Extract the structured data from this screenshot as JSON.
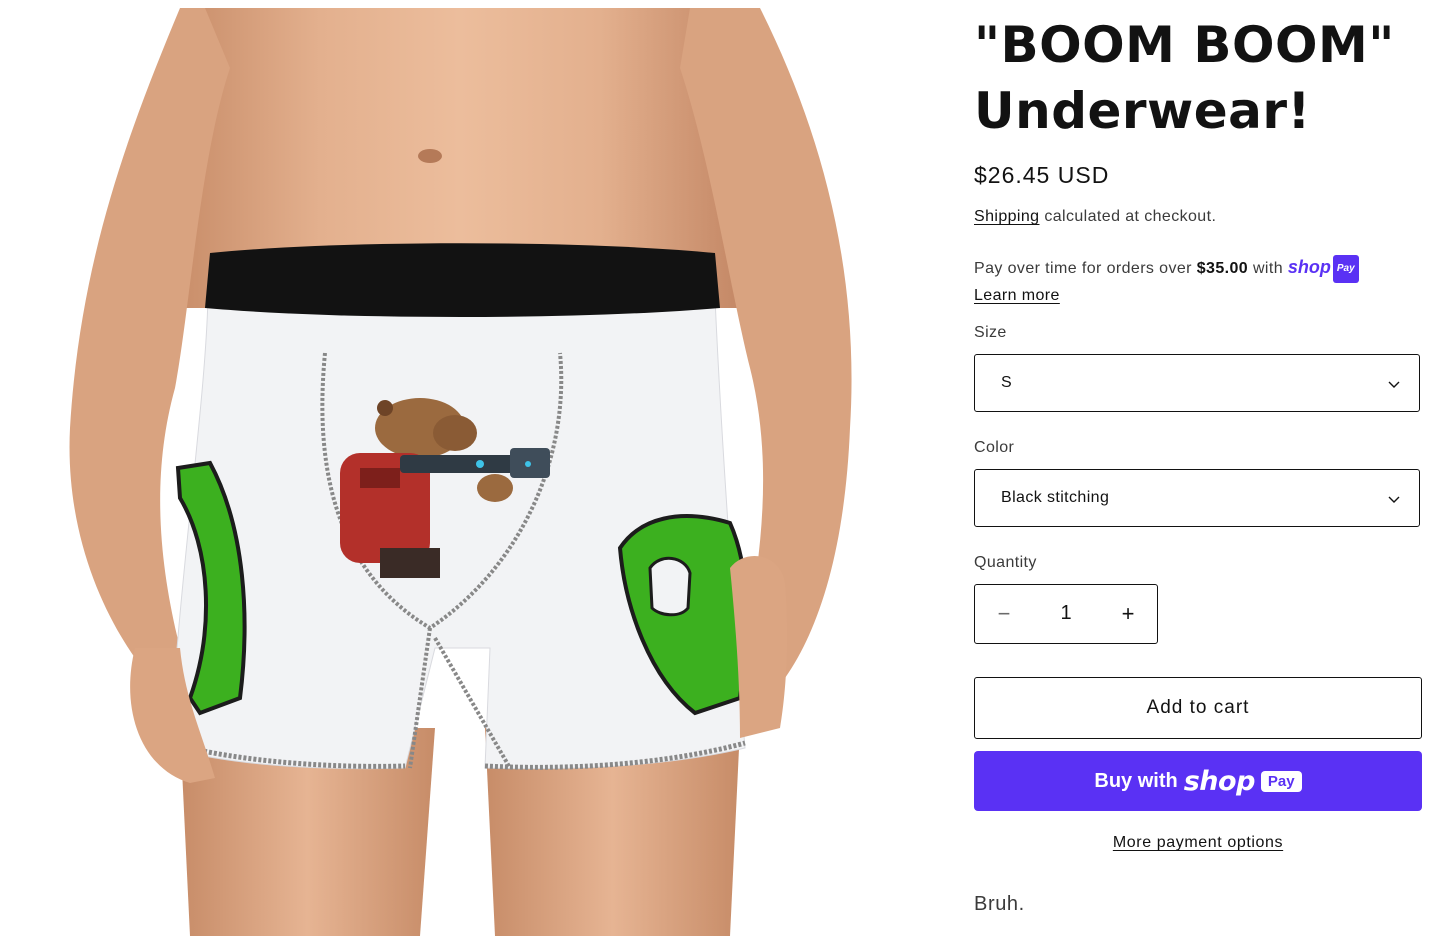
{
  "product": {
    "title_line1": "\"BOOM BOOM\"",
    "title_line2": "Underwear!",
    "price": "$26.45 USD",
    "shipping_link": "Shipping",
    "shipping_text": " calculated at checkout.",
    "installments": {
      "prefix": "Pay over time for orders over ",
      "amount": "$35.00",
      "suffix": " with ",
      "brand": "shop",
      "badge": "Pay",
      "learn_more": "Learn more"
    },
    "size": {
      "label": "Size",
      "selected": "S"
    },
    "color": {
      "label": "Color",
      "selected": "Black stitching"
    },
    "quantity": {
      "label": "Quantity",
      "value": "1",
      "minus": "−",
      "plus": "+"
    },
    "add_to_cart": "Add to cart",
    "buy_with_shop": {
      "prefix": "Buy with",
      "brand": "shop",
      "badge": "Pay"
    },
    "more_payment_options": "More payment options",
    "description": "Bruh."
  },
  "image": {
    "alt_subject": "model wearing white boxer briefs with black waistband, green letters and capybara print"
  },
  "colors": {
    "shop_purple": "#5a31f4",
    "text": "#121212",
    "letter_green": "#3cb01f"
  }
}
